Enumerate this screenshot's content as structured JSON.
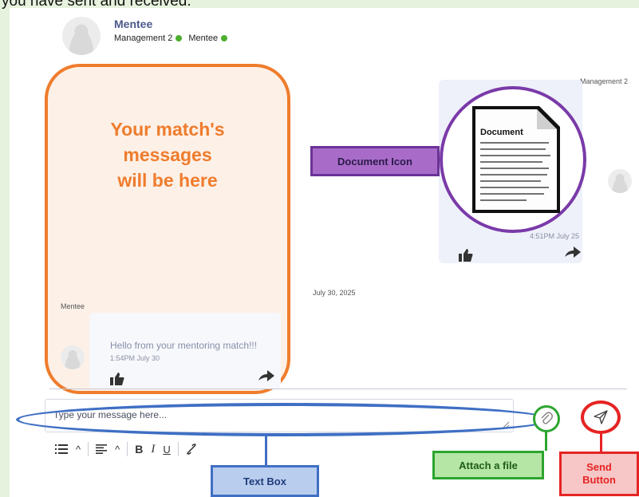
{
  "caption": "you have sent and received.",
  "header": {
    "name": "Mentee",
    "role_1": "Management 2",
    "role_2": "Mentee"
  },
  "right_sender_label": "Management 2",
  "left_sender_label": "Mentee",
  "date_separator": "July 30, 2025",
  "right_message": {
    "document_title": "Document",
    "time": "4:51PM July 25"
  },
  "left_message": {
    "text": "Hello from your mentoring match!!!",
    "time": "1:54PM July 30"
  },
  "annotations": {
    "orange_text": "Your match's messages will be here",
    "document_icon": "Document Icon",
    "text_box": "Text Box",
    "attach_file": "Attach a file",
    "send_button": "Send\nButton"
  },
  "composer": {
    "placeholder": "Type your message here...",
    "toolbar": [
      "list-icon",
      "caret-up-icon",
      "align-icon",
      "caret-up-icon",
      "B",
      "I",
      "U",
      "link-icon"
    ]
  },
  "colors": {
    "orange": "#ef7c2c",
    "purple": "#7a3aa8",
    "blue": "#3f6fc4",
    "green": "#2ca52f",
    "red": "#e52424",
    "page_bg": "#e7f2de"
  }
}
